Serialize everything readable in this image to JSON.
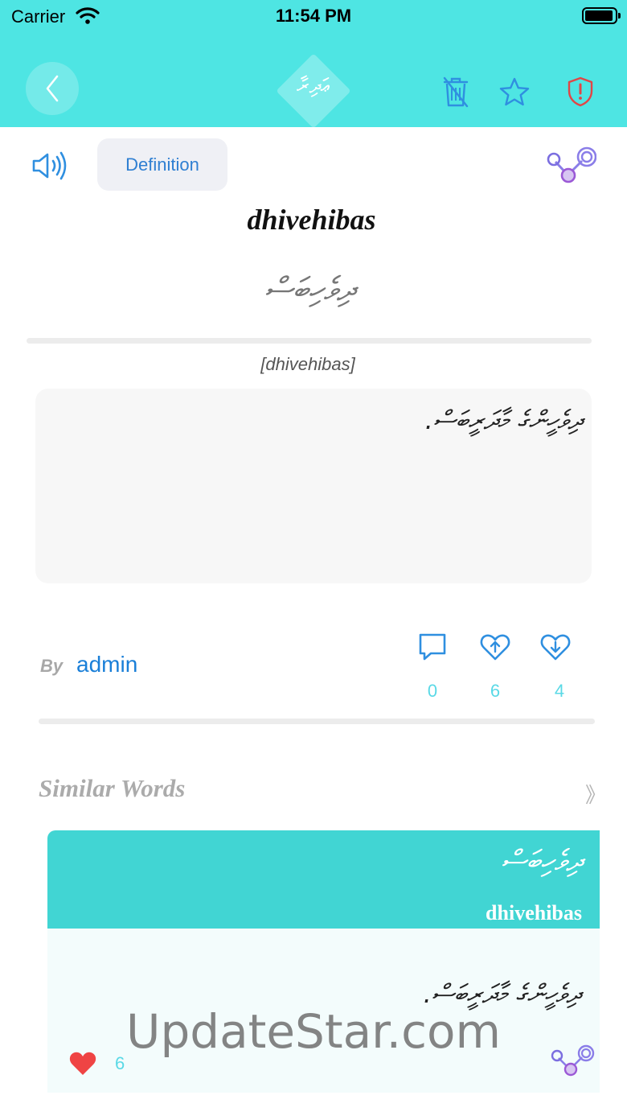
{
  "status_bar": {
    "carrier": "Carrier",
    "time": "11:54 PM"
  },
  "header": {
    "logo_text": "ޢަދިރާ",
    "icons": [
      "back-icon",
      "delete-icon",
      "star-icon",
      "report-icon"
    ]
  },
  "toolbar": {
    "definition_label": "Definition"
  },
  "word": {
    "latin": "dhivehibas",
    "thaana": "ދިވެހިބަސް",
    "pronunciation": "[dhivehibas]",
    "definition": "ދިވެހީންގެ މާދަރީބަސް."
  },
  "author": {
    "by_label": "By",
    "name": "admin"
  },
  "stats": {
    "comments": "0",
    "upvotes": "6",
    "downvotes": "4"
  },
  "similar": {
    "title": "Similar Words",
    "chevron": "》",
    "card": {
      "thaana": "ދިވެހިބަސް",
      "latin": "dhivehibas",
      "definition": "ދިވެހީންގެ މާދަރީބަސް.",
      "likes": "6"
    }
  },
  "watermark": "UpdateStar.com",
  "colors": {
    "header": "#4ee5e3",
    "accent": "#1a7fd8",
    "card_head": "#41d5d3",
    "heart": "#ef4444"
  }
}
